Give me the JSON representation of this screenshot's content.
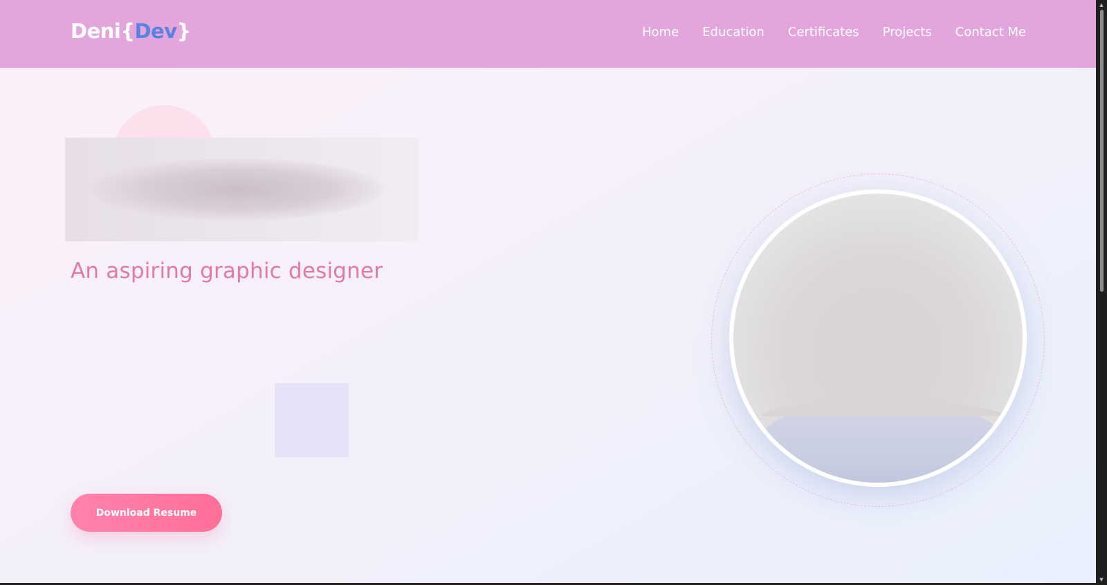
{
  "header": {
    "logo": {
      "name": "Deni",
      "open_brace": "{",
      "highlight": "Dev",
      "close_brace": "}"
    },
    "nav": [
      "Home",
      "Education",
      "Certificates",
      "Projects",
      "Contact Me"
    ]
  },
  "hero": {
    "subtitle": "An aspiring graphic designer",
    "download_button": "Download Resume"
  },
  "colors": {
    "header_bg": "#e3a6dc",
    "logo_accent": "#5a82e0",
    "subtitle": "#e27aa6",
    "button": "#ff78a2"
  },
  "icons": {
    "scroll_up": "▲",
    "scroll_down": "▼"
  }
}
